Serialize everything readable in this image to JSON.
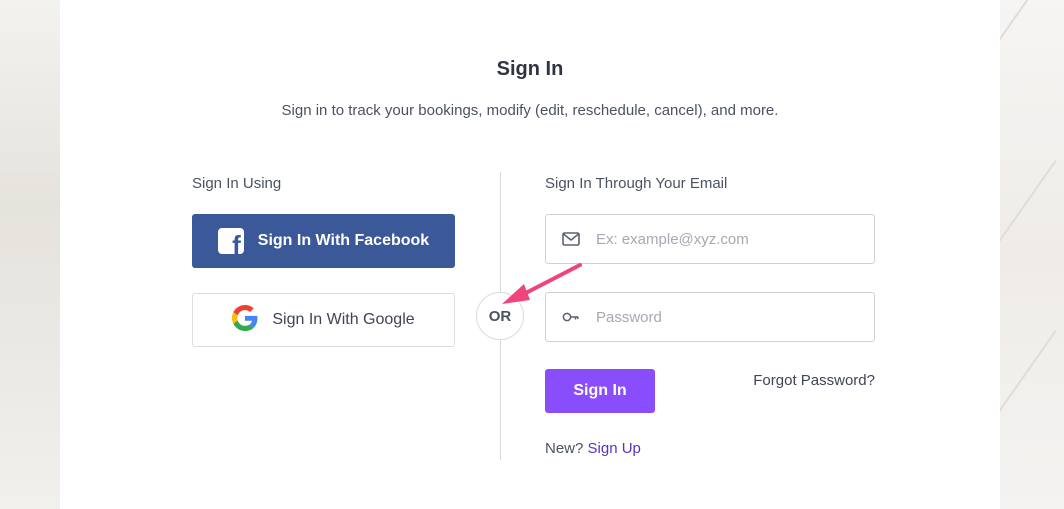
{
  "page": {
    "title": "Sign In",
    "subtitle": "Sign in to track your bookings, modify (edit, reschedule, cancel), and more."
  },
  "social": {
    "heading": "Sign In Using",
    "facebook_label": "Sign In With Facebook",
    "google_label": "Sign In With Google",
    "facebook_color": "#3b5998"
  },
  "separator": {
    "label": "OR"
  },
  "email_form": {
    "heading": "Sign In Through Your Email",
    "email_placeholder": "Ex: example@xyz.com",
    "email_icon": "envelope-icon",
    "password_placeholder": "Password",
    "password_icon": "key-icon",
    "submit_label": "Sign In",
    "submit_color": "#8a4dfb",
    "forgot_label": "Forgot Password?",
    "new_label": "New?",
    "signup_label": "Sign Up",
    "signup_color": "#5a33b8"
  },
  "annotation": {
    "arrow_color": "#f0457c",
    "arrow_icon": "annotation-arrow"
  }
}
